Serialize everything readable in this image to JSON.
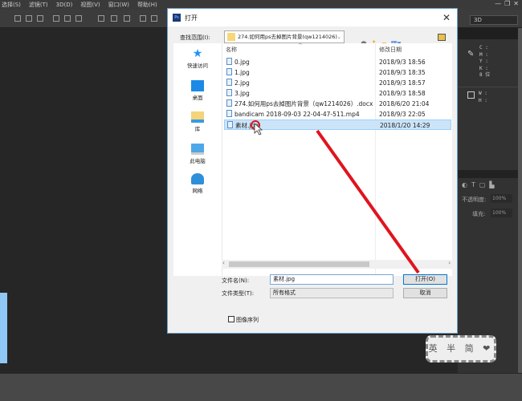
{
  "menubar": {
    "items": [
      "选择(S)",
      "滤镜(T)",
      "3D(D)",
      "视图(V)",
      "窗口(W)",
      "帮助(H)"
    ],
    "window_controls": [
      "—",
      "❐",
      "✕"
    ]
  },
  "toolbar": {
    "mode_dropdown": "3D"
  },
  "right_panel": {
    "info_labels": [
      "C :",
      "M :",
      "Y :",
      "K :",
      "8 位",
      "W :",
      "H :"
    ],
    "opacity_label": "不透明度:",
    "opacity_value": "100%",
    "fill_label": "填充:",
    "fill_value": "100%"
  },
  "dialog": {
    "title": "打开",
    "lookin_label": "查找范围(I):",
    "lookin_value": "274.如何用ps去掉图片背景(qw1214026)",
    "sidebar": [
      {
        "label": "快速访问",
        "icon": "star-icon"
      },
      {
        "label": "桌面",
        "icon": "desktop-icon"
      },
      {
        "label": "库",
        "icon": "library-icon"
      },
      {
        "label": "此电脑",
        "icon": "computer-icon"
      },
      {
        "label": "网络",
        "icon": "network-icon"
      }
    ],
    "columns": [
      "名称",
      "修改日期"
    ],
    "files": [
      {
        "name": "0.jpg",
        "date": "2018/9/3 18:56"
      },
      {
        "name": "1.jpg",
        "date": "2018/9/3 18:35"
      },
      {
        "name": "2.jpg",
        "date": "2018/9/3 18:57"
      },
      {
        "name": "3.jpg",
        "date": "2018/9/3 18:58"
      },
      {
        "name": "274.如何用ps去掉图片背景（qw1214026）.docx",
        "date": "2018/6/20 21:04"
      },
      {
        "name": "bandicam 2018-09-03 22-04-47-511.mp4",
        "date": "2018/9/3 22:05"
      },
      {
        "name": "素材.jpg",
        "date": "2018/1/20 14:29",
        "selected": true
      }
    ],
    "filename_label": "文件名(N):",
    "filename_value": "素材.jpg",
    "filetype_label": "文件类型(T):",
    "filetype_value": "所有格式",
    "open_button": "打开(O)",
    "cancel_button": "取消",
    "image_sequence_label": "图像序列"
  },
  "ime": {
    "label": "英 半 简 ❤"
  },
  "colors": {
    "annotation": "#e0141e",
    "selection": "#cce4f7"
  }
}
